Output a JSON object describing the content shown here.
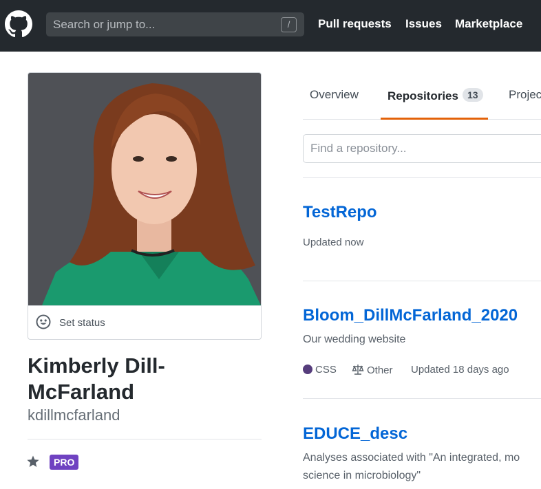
{
  "header": {
    "search_placeholder": "Search or jump to...",
    "search_shortcut": "/",
    "nav": [
      "Pull requests",
      "Issues",
      "Marketplace"
    ]
  },
  "profile": {
    "set_status_label": "Set status",
    "fullname": "Kimberly Dill-McFarland",
    "username": "kdillmcfarland",
    "pro_badge": "PRO"
  },
  "tabs": {
    "overview": "Overview",
    "repositories": "Repositories",
    "repositories_count": "13",
    "projects": "Projects"
  },
  "find_repo_placeholder": "Find a repository...",
  "repos": [
    {
      "name": "TestRepo",
      "updated": "Updated now"
    },
    {
      "name": "Bloom_DillMcFarland_2020",
      "description": "Our wedding website",
      "language": "CSS",
      "license": "Other",
      "updated": "Updated 18 days ago"
    },
    {
      "name": "EDUCE_desc",
      "description": "Analyses associated with \"An integrated, mo science in microbiology\""
    }
  ],
  "colors": {
    "header_bg": "#24292e",
    "link": "#0366d6",
    "active_tab": "#e36209",
    "pro": "#6f42c1",
    "css_lang": "#563d7c"
  },
  "icons": [
    "github-logo-icon",
    "smiley-icon",
    "star-icon",
    "scale-icon"
  ]
}
